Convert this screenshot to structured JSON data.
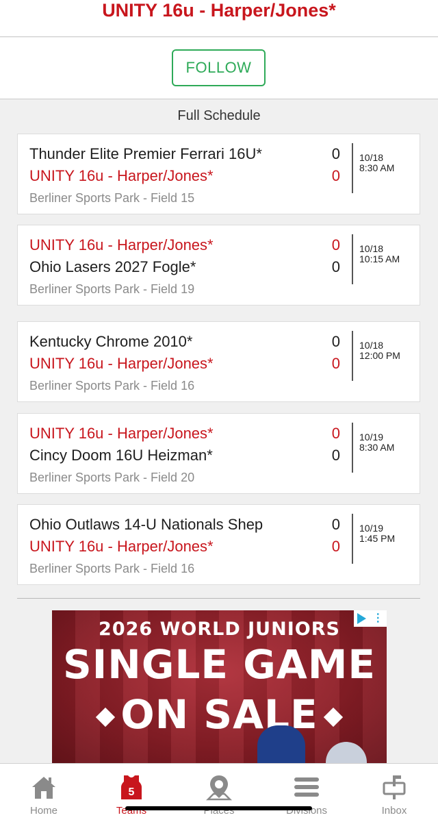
{
  "header": {
    "title": "UNITY 16u - Harper/Jones*"
  },
  "follow": {
    "label": "FOLLOW"
  },
  "schedule": {
    "heading": "Full Schedule",
    "games": [
      {
        "team1": "Thunder Elite Premier Ferrari 16U*",
        "team1_score": "0",
        "team1_is_self": false,
        "team2": "UNITY 16u - Harper/Jones*",
        "team2_score": "0",
        "team2_is_self": true,
        "date": "10/18",
        "time": "8:30 AM",
        "venue": "Berliner Sports Park - Field 15"
      },
      {
        "team1": "UNITY 16u - Harper/Jones*",
        "team1_score": "0",
        "team1_is_self": true,
        "team2": "Ohio Lasers 2027 Fogle*",
        "team2_score": "0",
        "team2_is_self": false,
        "date": "10/18",
        "time": "10:15 AM",
        "venue": "Berliner Sports Park - Field 19"
      },
      {
        "team1": "Kentucky Chrome 2010*",
        "team1_score": "0",
        "team1_is_self": false,
        "team2": "UNITY 16u - Harper/Jones*",
        "team2_score": "0",
        "team2_is_self": true,
        "date": "10/18",
        "time": "12:00 PM",
        "venue": "Berliner Sports Park - Field 16"
      },
      {
        "team1": "UNITY 16u - Harper/Jones*",
        "team1_score": "0",
        "team1_is_self": true,
        "team2": "Cincy Doom 16U Heizman*",
        "team2_score": "0",
        "team2_is_self": false,
        "date": "10/19",
        "time": "8:30 AM",
        "venue": "Berliner Sports Park - Field 20"
      },
      {
        "team1": "Ohio Outlaws 14-U Nationals Shep",
        "team1_score": "0",
        "team1_is_self": false,
        "team2": "UNITY 16u - Harper/Jones*",
        "team2_score": "0",
        "team2_is_self": true,
        "date": "10/19",
        "time": "1:45 PM",
        "venue": "Berliner Sports Park - Field 16"
      }
    ]
  },
  "ad": {
    "subtitle": "2026 WORLD JUNIORS",
    "line1": "SINGLE GAME",
    "line2": "ON SALE",
    "badge": "⋮"
  },
  "tabbar": {
    "active": "teams",
    "items": [
      {
        "id": "home",
        "label": "Home",
        "icon": "home-icon"
      },
      {
        "id": "teams",
        "label": "Teams",
        "icon": "jersey-icon",
        "badge": "5"
      },
      {
        "id": "places",
        "label": "Places",
        "icon": "map-pin-icon"
      },
      {
        "id": "divisions",
        "label": "Divisions",
        "icon": "menu-icon"
      },
      {
        "id": "inbox",
        "label": "Inbox",
        "icon": "mailbox-icon"
      }
    ]
  },
  "colors": {
    "brand_red": "#c8161d",
    "follow_green": "#2eaa58",
    "muted": "#8a8a8a"
  }
}
